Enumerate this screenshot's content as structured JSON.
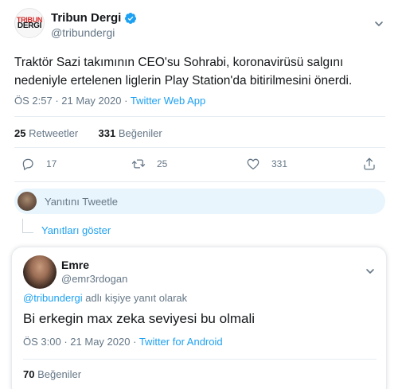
{
  "tweet": {
    "logo_line1": "TRIBUN",
    "logo_line2": "DERGI",
    "display_name": "Tribun Dergi",
    "handle": "@tribundergi",
    "text": "Traktör Sazi takımının CEO'su Sohrabi, koronavirüsü salgını nedeniyle ertelenen liglerin Play Station'da bitirilmesini önerdi.",
    "time": "ÖS 2:57",
    "separator": "·",
    "date": "21 May 2020",
    "app": "Twitter Web App",
    "retweets_count": "25",
    "retweets_label": "Retweetler",
    "likes_count": "331",
    "likes_label": "Beğeniler",
    "actions": {
      "reply_count": "17",
      "retweet_count": "25",
      "like_count": "331"
    }
  },
  "reply_bar": {
    "placeholder": "Yanıtını Tweetle"
  },
  "show_replies": {
    "label": "Yanıtları göster"
  },
  "reply": {
    "display_name": "Emre",
    "handle": "@emr3rdogan",
    "mention": "@tribundergi",
    "replying_suffix": "adlı kişiye yanıt olarak",
    "text": "Bi erkegin max zeka seviyesi bu olmali",
    "time": "ÖS 3:00",
    "separator": "·",
    "date": "21 May 2020",
    "app": "Twitter for Android",
    "likes_count": "70",
    "likes_label": "Beğeniler"
  },
  "colors": {
    "accent": "#1da1f2",
    "muted": "#657786",
    "text": "#14171a",
    "reply_bar_bg": "#e8f5fd",
    "logo_red": "#d32a2a"
  },
  "icons": [
    "verified-badge-icon",
    "chevron-down-icon",
    "reply-icon",
    "retweet-icon",
    "like-heart-icon",
    "share-icon"
  ]
}
